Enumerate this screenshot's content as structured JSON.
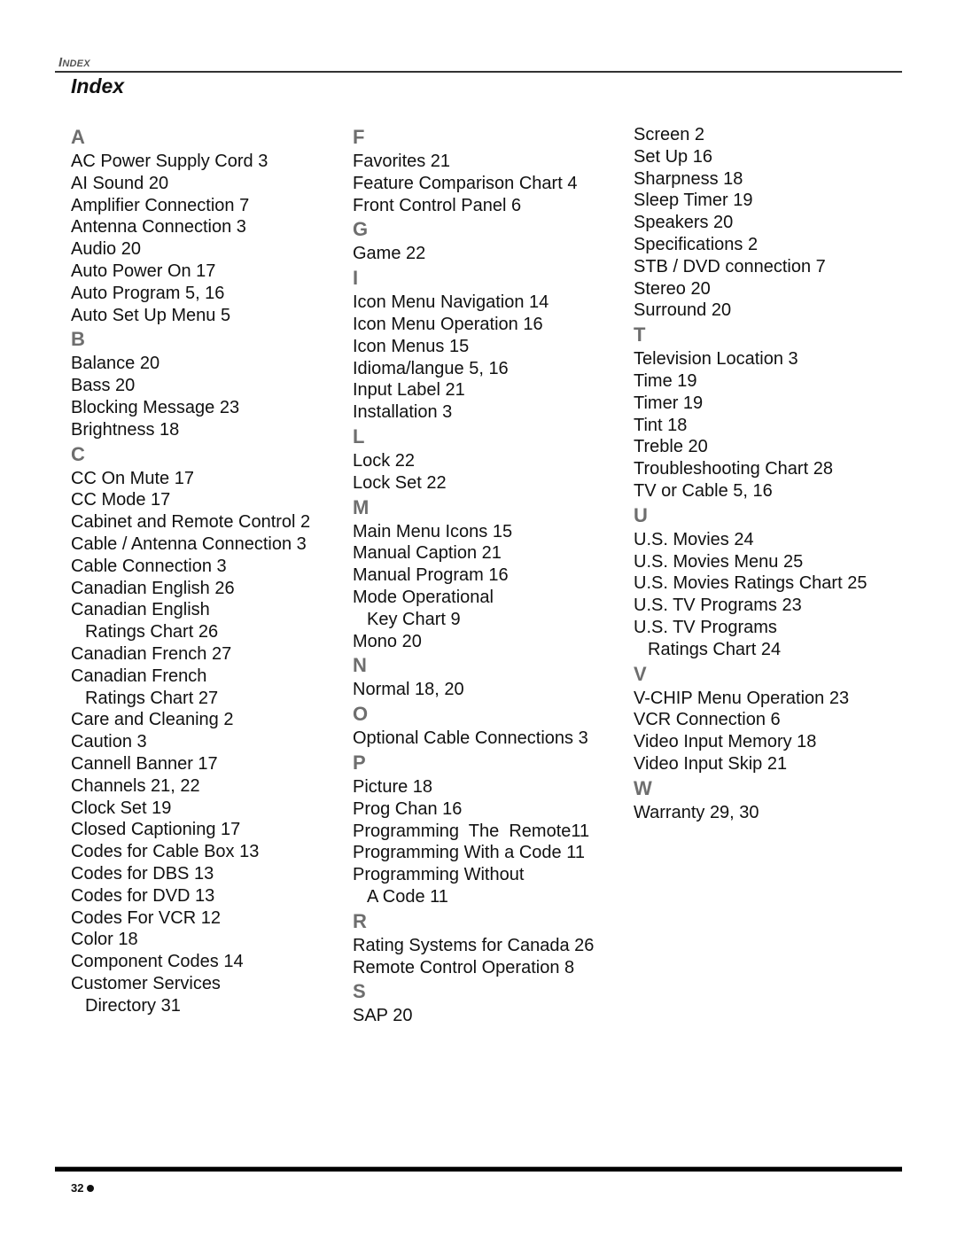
{
  "header": {
    "running_head_first": "I",
    "running_head_rest": "NDEX",
    "title": "Index"
  },
  "columns": [
    {
      "sections": [
        {
          "letter": "A",
          "entries": [
            {
              "text": "AC Power Supply Cord 3"
            },
            {
              "text": "AI Sound 20"
            },
            {
              "text": "Amplifier Connection 7"
            },
            {
              "text": "Antenna Connection 3"
            },
            {
              "text": "Audio 20"
            },
            {
              "text": "Auto Power On 17"
            },
            {
              "text": "Auto Program 5, 16"
            },
            {
              "text": "Auto Set Up Menu 5"
            }
          ]
        },
        {
          "letter": "B",
          "entries": [
            {
              "text": "Balance 20"
            },
            {
              "text": "Bass 20"
            },
            {
              "text": "Blocking Message 23"
            },
            {
              "text": "Brightness 18"
            }
          ]
        },
        {
          "letter": "C",
          "entries": [
            {
              "text": "CC On Mute 17"
            },
            {
              "text": "CC Mode 17"
            },
            {
              "text": "Cabinet and Remote Control 2"
            },
            {
              "text": "Cable / Antenna Connection 3"
            },
            {
              "text": "Cable Connection 3"
            },
            {
              "text": "Canadian English 26"
            },
            {
              "text": "Canadian English",
              "cont": "Ratings Chart 26"
            },
            {
              "text": "Canadian French 27"
            },
            {
              "text": "Canadian French",
              "cont": "Ratings Chart 27"
            },
            {
              "text": "Care and Cleaning 2"
            },
            {
              "text": "Caution 3"
            },
            {
              "text": "Cannell Banner 17"
            },
            {
              "text": "Channels 21, 22"
            },
            {
              "text": "Clock Set 19"
            },
            {
              "text": "Closed Captioning 17"
            },
            {
              "text": "Codes for Cable Box 13"
            },
            {
              "text": "Codes for DBS 13"
            },
            {
              "text": "Codes for DVD 13"
            },
            {
              "text": "Codes For VCR 12"
            },
            {
              "text": "Color 18"
            },
            {
              "text": "Component Codes 14"
            },
            {
              "text": "Customer Services",
              "cont": "Directory 31"
            }
          ]
        }
      ]
    },
    {
      "sections": [
        {
          "letter": "F",
          "entries": [
            {
              "text": "Favorites 21"
            },
            {
              "text": "Feature Comparison Chart 4"
            },
            {
              "text": "Front Control Panel 6"
            }
          ]
        },
        {
          "letter": "G",
          "entries": [
            {
              "text": "Game 22"
            }
          ]
        },
        {
          "letter": "I",
          "entries": [
            {
              "text": "Icon Menu Navigation 14"
            },
            {
              "text": "Icon Menu Operation 16"
            },
            {
              "text": "Icon Menus 15"
            },
            {
              "text": "Idioma/langue 5, 16"
            },
            {
              "text": "Input Label 21"
            },
            {
              "text": "Installation 3"
            }
          ]
        },
        {
          "letter": "L",
          "entries": [
            {
              "text": "Lock 22"
            },
            {
              "text": "Lock Set 22"
            }
          ]
        },
        {
          "letter": "M",
          "entries": [
            {
              "text": "Main Menu Icons 15"
            },
            {
              "text": "Manual Caption 21"
            },
            {
              "text": "Manual Program 16"
            },
            {
              "text": "Mode Operational",
              "cont": "Key Chart 9"
            },
            {
              "text": "Mono 20"
            }
          ]
        },
        {
          "letter": "N",
          "entries": [
            {
              "text": "Normal 18, 20"
            }
          ]
        },
        {
          "letter": "O",
          "entries": [
            {
              "text": "Optional Cable Connections 3"
            }
          ]
        },
        {
          "letter": "P",
          "entries": [
            {
              "text": "Picture 18"
            },
            {
              "text": "Prog Chan 16"
            },
            {
              "text": "Programming  The  Remote11"
            },
            {
              "text": "Programming With a Code 11"
            },
            {
              "text": "Programming Without",
              "cont": "A Code 11"
            }
          ]
        },
        {
          "letter": "R",
          "entries": [
            {
              "text": "Rating Systems for Canada 26"
            },
            {
              "text": "Remote Control Operation 8"
            }
          ]
        },
        {
          "letter": "S",
          "entries": [
            {
              "text": "SAP 20"
            }
          ]
        }
      ]
    },
    {
      "sections": [
        {
          "letter": "",
          "entries": [
            {
              "text": "Screen 2"
            },
            {
              "text": "Set Up 16"
            },
            {
              "text": "Sharpness 18"
            },
            {
              "text": "Sleep Timer 19"
            },
            {
              "text": "Speakers 20"
            },
            {
              "text": "Specifications 2"
            },
            {
              "text": "STB / DVD connection 7"
            },
            {
              "text": "Stereo 20"
            },
            {
              "text": "Surround 20"
            }
          ]
        },
        {
          "letter": "T",
          "entries": [
            {
              "text": "Television Location 3"
            },
            {
              "text": "Time 19"
            },
            {
              "text": "Timer 19"
            },
            {
              "text": "Tint 18"
            },
            {
              "text": "Treble 20"
            },
            {
              "text": "Troubleshooting Chart 28"
            },
            {
              "text": "TV or Cable 5, 16"
            }
          ]
        },
        {
          "letter": "U",
          "entries": [
            {
              "text": "U.S. Movies 24"
            },
            {
              "text": "U.S. Movies Menu 25"
            },
            {
              "text": "U.S. Movies Ratings Chart 25"
            },
            {
              "text": "U.S. TV Programs 23"
            },
            {
              "text": "U.S. TV Programs",
              "cont": "Ratings Chart 24"
            }
          ]
        },
        {
          "letter": "V",
          "entries": [
            {
              "text": "V-CHIP Menu Operation 23"
            },
            {
              "text": "VCR Connection 6"
            },
            {
              "text": "Video Input Memory 18"
            },
            {
              "text": "Video Input Skip 21"
            }
          ]
        },
        {
          "letter": "W",
          "entries": [
            {
              "text": "Warranty 29, 30"
            }
          ]
        }
      ]
    }
  ],
  "footer": {
    "page_number": "32",
    "bullet_icon": "filled-circle"
  }
}
